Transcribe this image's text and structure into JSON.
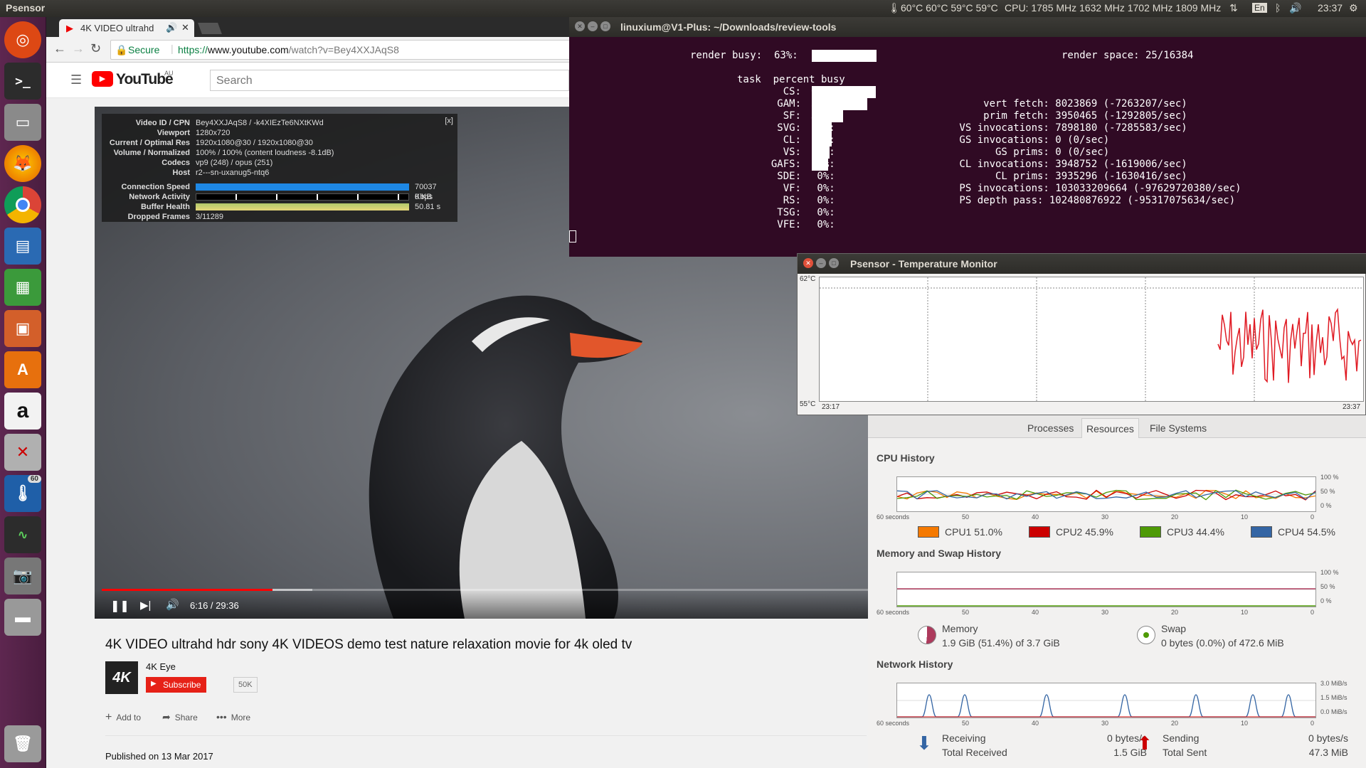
{
  "top_panel": {
    "app_name": "Psensor",
    "temps": "60°C 60°C 59°C 59°C",
    "cpu": "CPU: 1785 MHz 1632 MHz 1702 MHz 1809 MHz",
    "lang": "En",
    "clock": "23:37"
  },
  "launcher": {
    "items": [
      "ubuntu",
      "terminal",
      "files",
      "firefox",
      "chrome",
      "writer",
      "calc",
      "impress",
      "software",
      "amazon",
      "settings",
      "psensor",
      "system-monitor",
      "screenshot",
      "drive",
      "trash"
    ],
    "psensor_badge": "60"
  },
  "browser": {
    "tab_title": "4K VIDEO ultrahd",
    "secure_label": "Secure",
    "url_scheme": "https://",
    "url_host": "www.youtube.com",
    "url_path": "/watch?v=Bey4XXJAqS8",
    "logo_text": "YouTube",
    "logo_region": "AU",
    "search_placeholder": "Search"
  },
  "stats": {
    "close": "[x]",
    "rows": [
      {
        "k": "Video ID / CPN",
        "v": "Bey4XXJAqS8 / -k4XIEzTe6NXtKWd"
      },
      {
        "k": "Viewport",
        "v": "1280x720"
      },
      {
        "k": "Current / Optimal Res",
        "v": "1920x1080@30 / 1920x1080@30"
      },
      {
        "k": "Volume / Normalized",
        "v": "100% / 100% (content loudness -8.1dB)"
      },
      {
        "k": "Codecs",
        "v": "vp9 (248) / opus (251)"
      },
      {
        "k": "Host",
        "v": "r2---sn-uxanug5-ntq6"
      },
      {
        "k": "Connection Speed",
        "v": "70037 Kbps"
      },
      {
        "k": "Network Activity",
        "v": "0 KB"
      },
      {
        "k": "Buffer Health",
        "v": "50.81 s"
      },
      {
        "k": "Dropped Frames",
        "v": "3/11289"
      }
    ]
  },
  "player": {
    "time": "6:16 / 29:36",
    "progress": 0.212,
    "buffered": 0.262
  },
  "video": {
    "title": "4K VIDEO ultrahd hdr sony 4K VIDEOS demo test nature relaxation movie for 4k oled tv",
    "channel": "4K Eye",
    "channel_logo": "4K",
    "subscribe": "Subscribe",
    "subs": "50K",
    "add_to": "Add to",
    "share": "Share",
    "more": "More",
    "published": "Published on 13 Mar 2017"
  },
  "terminal": {
    "title": "linuxium@V1-Plus: ~/Downloads/review-tools",
    "render_busy": "render busy:  63%:",
    "render_busy_pct": 63,
    "render_space": "render space: 25/16384",
    "header": "task  percent busy",
    "tasks": [
      {
        "name": "CS:",
        "pct": 62
      },
      {
        "name": "GAM:",
        "pct": 54
      },
      {
        "name": "SF:",
        "pct": 30
      },
      {
        "name": "SVG:",
        "pct": 19
      },
      {
        "name": "CL:",
        "pct": 19
      },
      {
        "name": "VS:",
        "pct": 17
      },
      {
        "name": "GAFS:",
        "pct": 16
      },
      {
        "name": "SDE:",
        "pct": 0
      },
      {
        "name": "VF:",
        "pct": 0
      },
      {
        "name": "RS:",
        "pct": 0
      },
      {
        "name": "TSG:",
        "pct": 0
      },
      {
        "name": "VFE:",
        "pct": 0
      }
    ],
    "counters": [
      "     vert fetch: 8023869 (-7263207/sec)",
      "     prim fetch: 3950465 (-1292805/sec)",
      " VS invocations: 7898180 (-7285583/sec)",
      " GS invocations: 0 (0/sec)",
      "       GS prims: 0 (0/sec)",
      " CL invocations: 3948752 (-1619006/sec)",
      "       CL prims: 3935296 (-1630416/sec)",
      " PS invocations: 103033209664 (-97629720380/sec)",
      " PS depth pass: 102480876922 (-95317075634/sec)"
    ]
  },
  "psensor": {
    "title": "Psensor - Temperature Monitor",
    "ymax": "62°C",
    "ymin": "55°C",
    "tstart": "23:17",
    "tend": "23:37",
    "line_color": "#e01b24"
  },
  "sysmon": {
    "tabs": [
      "Processes",
      "Resources",
      "File Systems"
    ],
    "active_tab": "Resources",
    "cpu_title": "CPU History",
    "mem_title": "Memory and Swap History",
    "net_title": "Network History",
    "x_labels": [
      "60 seconds",
      "50",
      "40",
      "30",
      "20",
      "10",
      "0"
    ],
    "pct_labels": [
      "100 %",
      "50 %",
      "0 %"
    ],
    "net_labels": [
      "3.0 MiB/s",
      "1.5 MiB/s",
      "0.0 MiB/s"
    ],
    "cpus": [
      {
        "label": "CPU1  51.0%",
        "color": "#f57900"
      },
      {
        "label": "CPU2  45.9%",
        "color": "#cc0000"
      },
      {
        "label": "CPU3  44.4%",
        "color": "#4e9a06"
      },
      {
        "label": "CPU4  54.5%",
        "color": "#3465a4"
      }
    ],
    "memory": {
      "title": "Memory",
      "value": "1.9 GiB (51.4%) of 3.7 GiB",
      "color": "#ad3a5c"
    },
    "swap": {
      "title": "Swap",
      "value": "0 bytes (0.0%) of 472.6 MiB",
      "color": "#4e9a06"
    },
    "receiving": {
      "title": "Receiving",
      "rate": "0 bytes/s",
      "total_label": "Total Received",
      "total": "1.5 GiB"
    },
    "sending": {
      "title": "Sending",
      "rate": "0 bytes/s",
      "total_label": "Total Sent",
      "total": "47.3 MiB"
    }
  }
}
